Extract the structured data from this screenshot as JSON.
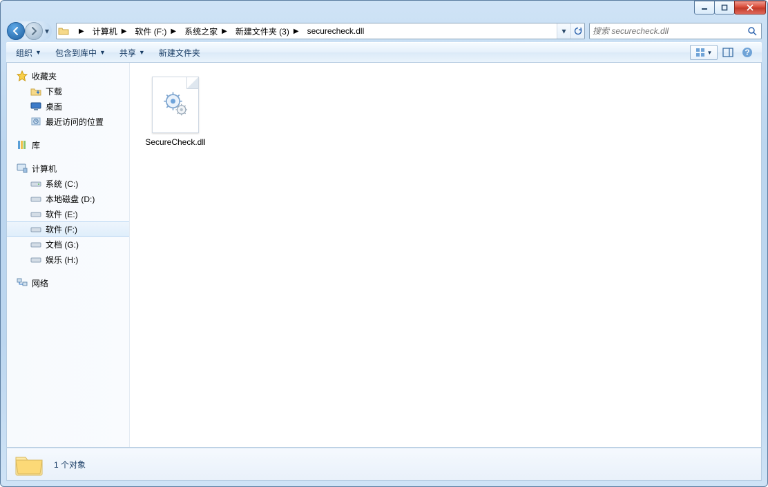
{
  "breadcrumbs": [
    "计算机",
    "软件 (F:)",
    "系统之家",
    "新建文件夹 (3)",
    "securecheck.dll"
  ],
  "search": {
    "placeholder": "搜索 securecheck.dll"
  },
  "toolbar": {
    "organize": "组织",
    "include": "包含到库中",
    "share": "共享",
    "newfolder": "新建文件夹"
  },
  "sidebar": {
    "favorites": {
      "label": "收藏夹",
      "items": [
        "下载",
        "桌面",
        "最近访问的位置"
      ]
    },
    "libraries": {
      "label": "库"
    },
    "computer": {
      "label": "计算机",
      "drives": [
        "系统 (C:)",
        "本地磁盘 (D:)",
        "软件 (E:)",
        "软件 (F:)",
        "文档 (G:)",
        "娱乐 (H:)"
      ],
      "selectedIndex": 3
    },
    "network": {
      "label": "网络"
    }
  },
  "files": [
    {
      "name": "SecureCheck.dll"
    }
  ],
  "status": {
    "count_label": "1 个对象"
  }
}
